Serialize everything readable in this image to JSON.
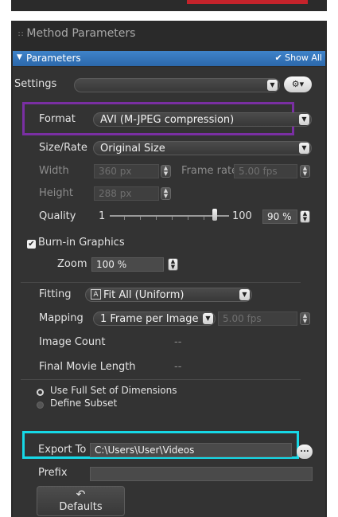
{
  "panel": {
    "title": "Method Parameters",
    "section": {
      "label": "Parameters",
      "show_all": "Show All"
    }
  },
  "settings": {
    "label": "Settings",
    "value": ""
  },
  "format": {
    "label": "Format",
    "value": "AVI (M-JPEG compression)"
  },
  "size_rate": {
    "label": "Size/Rate",
    "value": "Original Size"
  },
  "width": {
    "label": "Width",
    "value": "360 px"
  },
  "frame_rate": {
    "label": "Frame rate",
    "value": "5.00 fps"
  },
  "height": {
    "label": "Height",
    "value": "288 px"
  },
  "quality": {
    "label": "Quality",
    "min": "1",
    "max": "100",
    "value": "90 %",
    "level": 90
  },
  "burn_in": {
    "label": "Burn-in Graphics",
    "checked": true
  },
  "zoom": {
    "label": "Zoom",
    "value": "100 %"
  },
  "fitting": {
    "label": "Fitting",
    "value": "Fit All (Uniform)"
  },
  "mapping": {
    "label": "Mapping",
    "value": "1 Frame per Image",
    "fps": "5.00 fps"
  },
  "image_count": {
    "label": "Image Count",
    "value": "--"
  },
  "final_length": {
    "label": "Final Movie Length",
    "value": "--"
  },
  "dimensions": {
    "use_full": "Use Full Set of Dimensions",
    "define_subset": "Define Subset",
    "selected": "use_full"
  },
  "export_to": {
    "label": "Export To",
    "value": "C:\\Users\\User\\Videos",
    "browse": "..."
  },
  "prefix": {
    "label": "Prefix",
    "value": ""
  },
  "defaults": {
    "label": "Defaults"
  },
  "colors": {
    "panel_bg": "#333333",
    "header_blue": "#3f83c9",
    "highlight_purple": "#7a2fa3",
    "highlight_cyan": "#16d8e6"
  },
  "icons": [
    "grip-icon",
    "collapse-arrow-icon",
    "checkmark-icon",
    "gear-icon",
    "chevron-down-icon",
    "spin-icon",
    "fit-icon",
    "undo-icon"
  ]
}
